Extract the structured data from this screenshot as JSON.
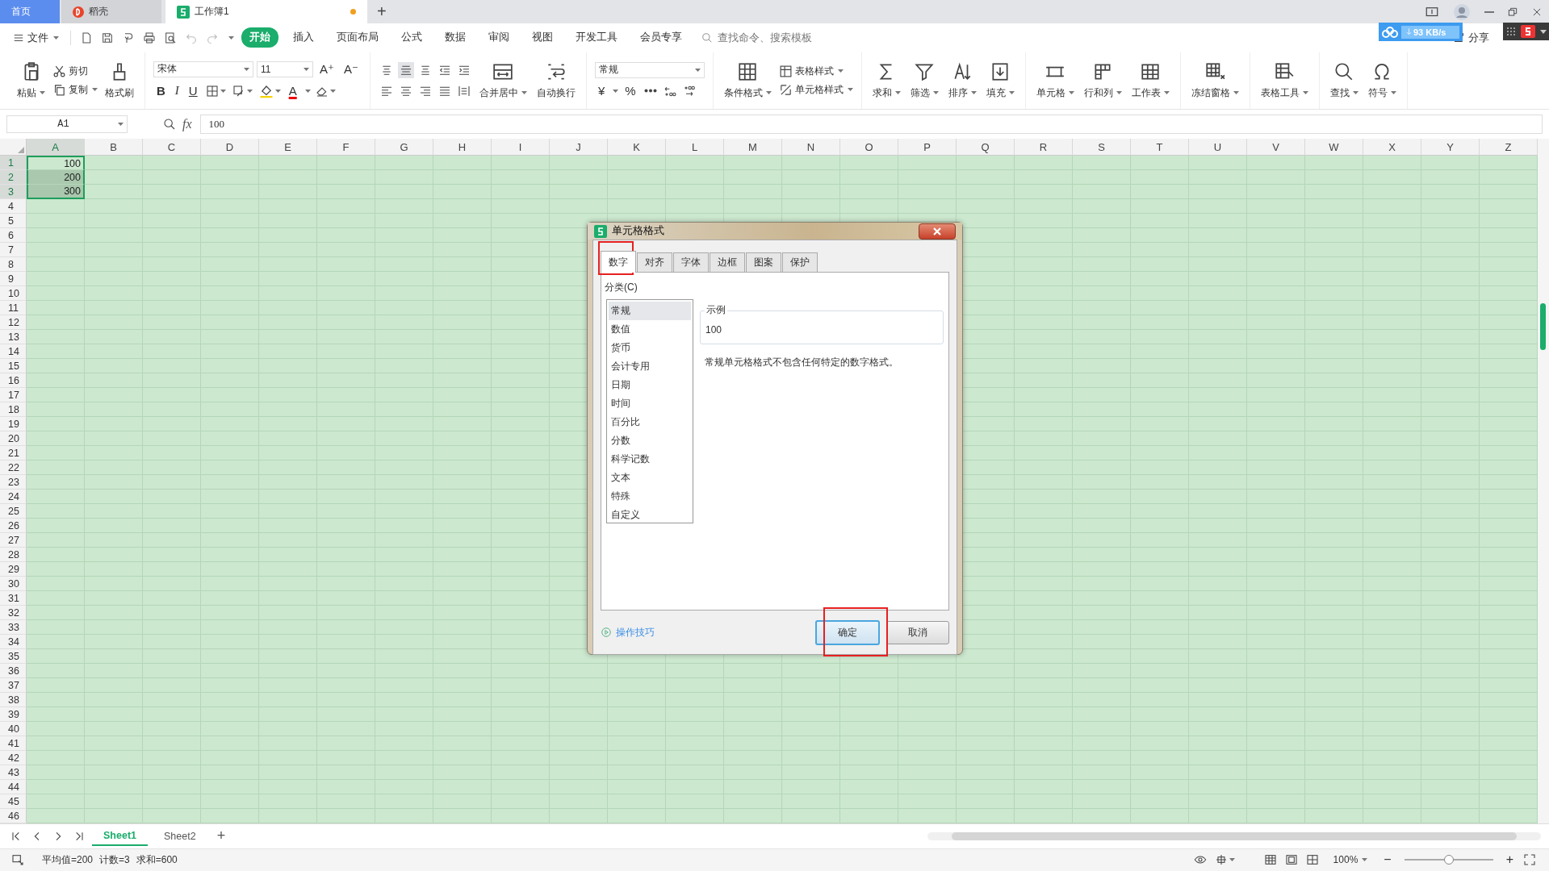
{
  "tabs": [
    {
      "label": "首页",
      "kind": "home",
      "selected": false
    },
    {
      "label": "稻壳",
      "kind": "docer",
      "selected": false
    },
    {
      "label": "工作簿1",
      "kind": "sheet",
      "selected": true,
      "unsaved": true
    }
  ],
  "new_tab": "+",
  "menu": {
    "file": "文件",
    "items": [
      {
        "label": "开始",
        "selected": true
      },
      {
        "label": "插入",
        "selected": false
      },
      {
        "label": "页面布局",
        "selected": false
      },
      {
        "label": "公式",
        "selected": false
      },
      {
        "label": "数据",
        "selected": false
      },
      {
        "label": "审阅",
        "selected": false
      },
      {
        "label": "视图",
        "selected": false
      },
      {
        "label": "开发工具",
        "selected": false
      },
      {
        "label": "会员专享",
        "selected": false
      }
    ],
    "search": {
      "placeholder": "查找命令、搜索模板"
    },
    "share": "分享",
    "net_speed": "93 KB/s"
  },
  "ribbon": [
    {
      "kind": "clipboard",
      "items": [
        {
          "label": "粘贴",
          "caret": true
        },
        {
          "label": "剪切",
          "caret": false
        },
        {
          "label": "复制",
          "caret": true
        },
        {
          "label": "格式刷",
          "caret": false
        }
      ]
    },
    {
      "kind": "font",
      "font": "宋体",
      "size": "11",
      "grow": "A⁺",
      "shrink": "A⁻",
      "bold": "B",
      "italic": "I",
      "underline": "U",
      "font_color": "A"
    },
    {
      "kind": "align",
      "buttons": [
        {
          "label": "合并居中",
          "caret": true
        },
        {
          "label": "自动换行",
          "caret": false
        }
      ]
    },
    {
      "kind": "number",
      "format": "常规",
      "currency": "¥",
      "percent": "%"
    },
    {
      "kind": "styles",
      "big": {
        "label": "条件格式",
        "caret": true
      },
      "small": [
        {
          "label": "表格样式",
          "caret": true
        },
        {
          "label": "单元格样式",
          "caret": true
        }
      ]
    },
    {
      "kind": "bigs",
      "items": [
        {
          "label": "求和",
          "caret": true
        },
        {
          "label": "筛选",
          "caret": true
        },
        {
          "label": "排序",
          "caret": true
        },
        {
          "label": "填充",
          "caret": true
        }
      ]
    },
    {
      "kind": "bigs",
      "items": [
        {
          "label": "单元格",
          "caret": true
        },
        {
          "label": "行和列",
          "caret": true
        },
        {
          "label": "工作表",
          "caret": true
        }
      ]
    },
    {
      "kind": "bigs",
      "items": [
        {
          "label": "冻结窗格",
          "caret": true
        }
      ]
    },
    {
      "kind": "bigs",
      "items": [
        {
          "label": "表格工具",
          "caret": true
        }
      ]
    },
    {
      "kind": "bigs",
      "items": [
        {
          "label": "查找",
          "caret": true
        },
        {
          "label": "符号",
          "caret": true
        }
      ]
    }
  ],
  "name_box": "A1",
  "function_label": "fx",
  "formula": "100",
  "columns": [
    "A",
    "B",
    "C",
    "D",
    "E",
    "F",
    "G",
    "H",
    "I",
    "J",
    "K",
    "L",
    "M",
    "N",
    "O",
    "P",
    "Q",
    "R",
    "S",
    "T",
    "U",
    "V",
    "W",
    "X",
    "Y",
    "Z"
  ],
  "row_numbers": [
    "1",
    "2",
    "3",
    "4",
    "5",
    "6",
    "7",
    "8",
    "9",
    "10",
    "11",
    "12",
    "13",
    "14",
    "15",
    "16",
    "17",
    "18",
    "19",
    "20",
    "21",
    "22",
    "23",
    "24",
    "25",
    "26",
    "27",
    "28",
    "29",
    "30",
    "31",
    "32",
    "33",
    "34",
    "35",
    "36",
    "37",
    "38",
    "39",
    "40",
    "41",
    "42",
    "43",
    "44",
    "45",
    "46"
  ],
  "sheet_rows": [
    [
      {
        "value": "100",
        "selected": true,
        "active": true
      }
    ],
    [
      {
        "value": "200",
        "selected": true,
        "active": false
      }
    ],
    [
      {
        "value": "300",
        "selected": true,
        "active": false
      }
    ]
  ],
  "dialog": {
    "title": "单元格格式",
    "tabs": [
      {
        "label": "数字",
        "selected": true,
        "highlighted": true
      },
      {
        "label": "对齐",
        "selected": false,
        "highlighted": false
      },
      {
        "label": "字体",
        "selected": false,
        "highlighted": false
      },
      {
        "label": "边框",
        "selected": false,
        "highlighted": false
      },
      {
        "label": "图案",
        "selected": false,
        "highlighted": false
      },
      {
        "label": "保护",
        "selected": false,
        "highlighted": false
      }
    ],
    "category_label": "分类(C)",
    "categories": [
      {
        "label": "常规",
        "selected": true
      },
      {
        "label": "数值",
        "selected": false
      },
      {
        "label": "货币",
        "selected": false
      },
      {
        "label": "会计专用",
        "selected": false
      },
      {
        "label": "日期",
        "selected": false
      },
      {
        "label": "时间",
        "selected": false
      },
      {
        "label": "百分比",
        "selected": false
      },
      {
        "label": "分数",
        "selected": false
      },
      {
        "label": "科学记数",
        "selected": false
      },
      {
        "label": "文本",
        "selected": false
      },
      {
        "label": "特殊",
        "selected": false
      },
      {
        "label": "自定义",
        "selected": false
      }
    ],
    "sample_label": "示例",
    "sample": "100",
    "description": "常规单元格格式不包含任何特定的数字格式。",
    "tips_link": "操作技巧",
    "buttons": [
      {
        "label": "确定",
        "default": true,
        "highlighted": true
      },
      {
        "label": "取消",
        "default": false,
        "highlighted": false
      }
    ]
  },
  "sheet_tabs": [
    {
      "label": "Sheet1",
      "selected": true
    },
    {
      "label": "Sheet2",
      "selected": false
    }
  ],
  "add_sheet": "+",
  "status": {
    "stats": [
      "平均值=200",
      "计数=3",
      "求和=600"
    ],
    "zoom": "100%",
    "zoom_out": "−",
    "zoom_in": "+",
    "zoom_slider": {
      "level": 0.5
    }
  }
}
